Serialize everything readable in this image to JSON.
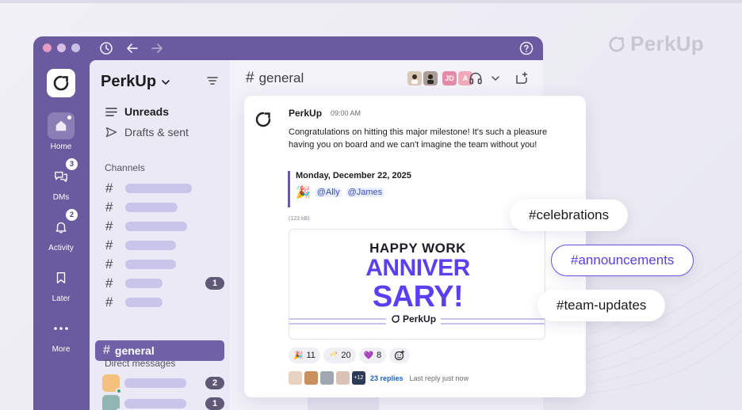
{
  "brand": {
    "name": "PerkUp"
  },
  "window": {
    "titlebar_icons": [
      "history-icon",
      "back-arrow-icon",
      "forward-arrow-icon",
      "help-icon"
    ]
  },
  "rail": {
    "items": [
      {
        "id": "home",
        "label": "Home",
        "badge": ""
      },
      {
        "id": "dms",
        "label": "DMs",
        "badge": "3"
      },
      {
        "id": "activity",
        "label": "Activity",
        "badge": "2"
      },
      {
        "id": "later",
        "label": "Later",
        "badge": ""
      },
      {
        "id": "more",
        "label": "More",
        "badge": ""
      }
    ]
  },
  "sidebar": {
    "workspace_name": "PerkUp",
    "unreads_label": "Unreads",
    "drafts_label": "Drafts & sent",
    "channels_heading": "Channels",
    "channel_rows": [
      {
        "unread": ""
      },
      {
        "unread": ""
      },
      {
        "unread": ""
      },
      {
        "unread": ""
      },
      {
        "unread": ""
      },
      {
        "unread": "1"
      },
      {
        "unread": ""
      }
    ],
    "active_channel": "general",
    "dm_heading": "Direct messages",
    "dm_rows": [
      {
        "count": "2"
      },
      {
        "count": "1"
      }
    ]
  },
  "main": {
    "channel_name": "general",
    "header_initials": [
      "JD",
      "A"
    ],
    "message": {
      "author": "PerkUp",
      "time": "09:00 AM",
      "text": "Congratulations on hitting this major milestone! It's such a pleasure having you on board and we can't imagine the team without you!",
      "quote_date": "Monday, December 22, 2025",
      "quote_emoji": "🎉",
      "mentions": [
        "@Ally",
        "@James"
      ],
      "file_size": "(123 kB)",
      "gif": {
        "line1": "HAPPY WORK",
        "line2": "ANNIVER",
        "line3": "SARY!",
        "brand": "PerkUp"
      },
      "reactions": [
        {
          "emoji": "🎉",
          "count": "11"
        },
        {
          "emoji": "🥂",
          "count": "20"
        },
        {
          "emoji": "💜",
          "count": "8"
        }
      ],
      "thread": {
        "more_count": "+12",
        "replies": "23 replies",
        "last_reply": "Last reply just now"
      }
    }
  },
  "tags": [
    "#celebrations",
    "#announcements",
    "#team-updates"
  ],
  "colors": {
    "rail_purple": "#6a5a9f",
    "sidebar_bg": "#ebe9f6",
    "active_channel": "#6f61a8",
    "accent": "#5b3ff0"
  }
}
